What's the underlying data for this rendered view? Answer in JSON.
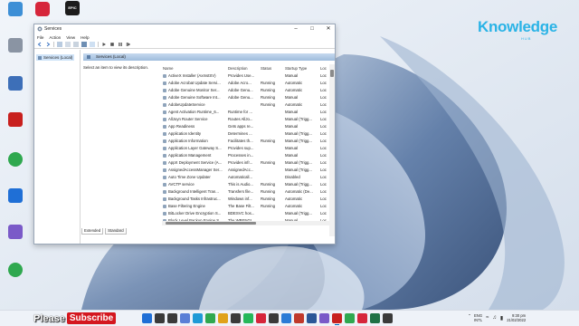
{
  "desktop": {
    "icons": [
      {
        "label": "",
        "color": "#e23b3b"
      },
      {
        "label": "",
        "color": "#2b2b2b"
      },
      {
        "label": "",
        "color": "#3d8fd6"
      },
      {
        "label": "",
        "color": "#8a94a3"
      },
      {
        "label": "",
        "color": "#3d6fb8"
      },
      {
        "label": "",
        "color": "#c8201e"
      },
      {
        "label": "",
        "color": "#2fa84f"
      },
      {
        "label": "",
        "color": "#1f6fd6"
      },
      {
        "label": "",
        "color": "#7a5ac8"
      },
      {
        "label": "",
        "color": "#2fa84f"
      }
    ],
    "top_icons": [
      {
        "label": "",
        "color": "#d6263b"
      },
      {
        "label": "EPIC",
        "color": "#1c1c1c"
      }
    ]
  },
  "logo": {
    "text": "Knowledge",
    "sub": "HUB",
    "color": "#2ab3e6"
  },
  "window": {
    "title": "Services",
    "menu": [
      "File",
      "Action",
      "View",
      "Help"
    ],
    "tree_node": "Services (Local)",
    "header_title": "Services (Local)",
    "description": "Select an item to view its description.",
    "columns": [
      "Name",
      "Description",
      "Status",
      "Startup Type",
      "Loc"
    ],
    "rows": [
      [
        "ActiveX Installer (AxInstSV)",
        "Provides Use...",
        "",
        "Manual",
        "Loc"
      ],
      [
        "Adobe Acrobat Update Servi...",
        "Adobe Acro...",
        "Running",
        "Automatic",
        "Loc"
      ],
      [
        "Adobe Genuine Monitor Ser...",
        "Adobe Genu...",
        "Running",
        "Automatic",
        "Loc"
      ],
      [
        "Adobe Genuine Software Int...",
        "Adobe Genu...",
        "Running",
        "Manual",
        "Loc"
      ],
      [
        "AdobeUpdateService",
        "",
        "Running",
        "Automatic",
        "Loc"
      ],
      [
        "Agent Activation Runtime_6...",
        "Runtime for ...",
        "",
        "Manual",
        "Loc"
      ],
      [
        "AllJoyn Router Service",
        "Routes AllJo...",
        "",
        "Manual (Trigg...",
        "Loc"
      ],
      [
        "App Readiness",
        "Gets apps re...",
        "",
        "Manual",
        "Loc"
      ],
      [
        "Application Identity",
        "Determines ...",
        "",
        "Manual (Trigg...",
        "Loc"
      ],
      [
        "Application Information",
        "Facilitates th...",
        "Running",
        "Manual (Trigg...",
        "Loc"
      ],
      [
        "Application Layer Gateway S...",
        "Provides sup...",
        "",
        "Manual",
        "Loc"
      ],
      [
        "Application Management",
        "Processes in...",
        "",
        "Manual",
        "Loc"
      ],
      [
        "AppX Deployment Service (A...",
        "Provides infr...",
        "Running",
        "Manual (Trigg...",
        "Loc"
      ],
      [
        "AssignedAccessManager Ser...",
        "AssignedAcc...",
        "",
        "Manual (Trigg...",
        "Loc"
      ],
      [
        "Auto Time Zone Updater",
        "Automaticall...",
        "",
        "Disabled",
        "Loc"
      ],
      [
        "AVCTP service",
        "This is Audio...",
        "Running",
        "Manual (Trigg...",
        "Loc"
      ],
      [
        "Background Intelligent Tran...",
        "Transfers file...",
        "Running",
        "Automatic (De...",
        "Loc"
      ],
      [
        "Background Tasks Infrastruc...",
        "Windows inf...",
        "Running",
        "Automatic",
        "Loc"
      ],
      [
        "Base Filtering Engine",
        "The Base Filt...",
        "Running",
        "Automatic",
        "Loc"
      ],
      [
        "BitLocker Drive Encryption S...",
        "BDESVC hos...",
        "",
        "Manual (Trigg...",
        "Loc"
      ],
      [
        "Block Level Backup Engine S...",
        "The WBENGI...",
        "",
        "Manual",
        "Loc"
      ]
    ],
    "tabs": [
      "Extended",
      "Standard"
    ]
  },
  "taskbar": {
    "please": "Please",
    "subscribe": "Subscribe",
    "apps": [
      "#1f6fd6",
      "#3a3a3a",
      "#3a3a3a",
      "#5a7fd6",
      "#1f9ad6",
      "#2fa84f",
      "#e0a21a",
      "#3a3a3a",
      "#25b85a",
      "#d6263b",
      "#3a3a3a",
      "#2a7bd6",
      "#c0392b",
      "#2b5797",
      "#7a5ac8",
      "#c8201e",
      "#2fa84f",
      "#d6263b",
      "#1e7145",
      "#3a3a3a"
    ],
    "lang_top": "ENG",
    "lang_bottom": "INTL",
    "time": "9:30 pm",
    "date": "21/02/2022"
  }
}
